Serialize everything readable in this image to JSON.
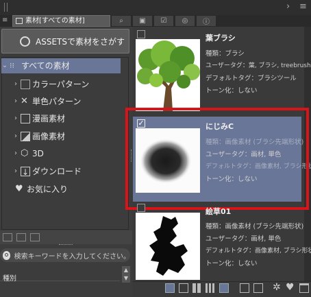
{
  "window": {
    "tab_label": "素材[すべての素材]",
    "tab_icons": [
      "search-icon",
      "palette-icon",
      "checkbox-icon",
      "globe-icon",
      "info-icon"
    ]
  },
  "assets_button": {
    "label": "ASSETSで素材をさがす"
  },
  "tree": {
    "items": [
      {
        "label": "すべての素材",
        "icon": "grid-dots-icon",
        "selected": true
      },
      {
        "label": "カラーパターン",
        "icon": "color-pattern-icon"
      },
      {
        "label": "単色パターン",
        "icon": "mono-pattern-icon"
      },
      {
        "label": "漫画素材",
        "icon": "manga-icon"
      },
      {
        "label": "画像素材",
        "icon": "image-icon"
      },
      {
        "label": "3D",
        "icon": "cube-icon"
      },
      {
        "label": "ダウンロード",
        "icon": "download-icon"
      },
      {
        "label": "お気に入り",
        "icon": "heart-icon"
      }
    ]
  },
  "search": {
    "placeholder": "検索キーワードを入力してください。"
  },
  "filter": {
    "label": "種別"
  },
  "materials": [
    {
      "title": "葉ブラシ",
      "type": "種類：ブラシ",
      "user_tag": "ユーザータグ：葉, ブラシ, treebrush",
      "default_tag": "デフォルトタグ：ブラシツール",
      "tone": "トーン化：しない",
      "checked": false
    },
    {
      "title": "にじみC",
      "type": "種類：画像素材 (ブラシ先端形状)",
      "user_tag": "ユーザータグ：画材, 単色",
      "default_tag": "デフォルトタグ：画像素材, ブラシ形状",
      "tone": "トーン化：しない",
      "checked": true
    },
    {
      "title": "絵草01",
      "type": "種類：画像素材 (ブラシ先端形状)",
      "user_tag": "ユーザータグ：画材, 単色",
      "default_tag": "デフォルトタグ：画像素材, ブラシ形状",
      "tone": "トーン化：しない",
      "checked": false
    }
  ],
  "colors": {
    "selection": "#6a7698",
    "highlight_border": "#d8141b",
    "panel": "#3a3a3a"
  }
}
